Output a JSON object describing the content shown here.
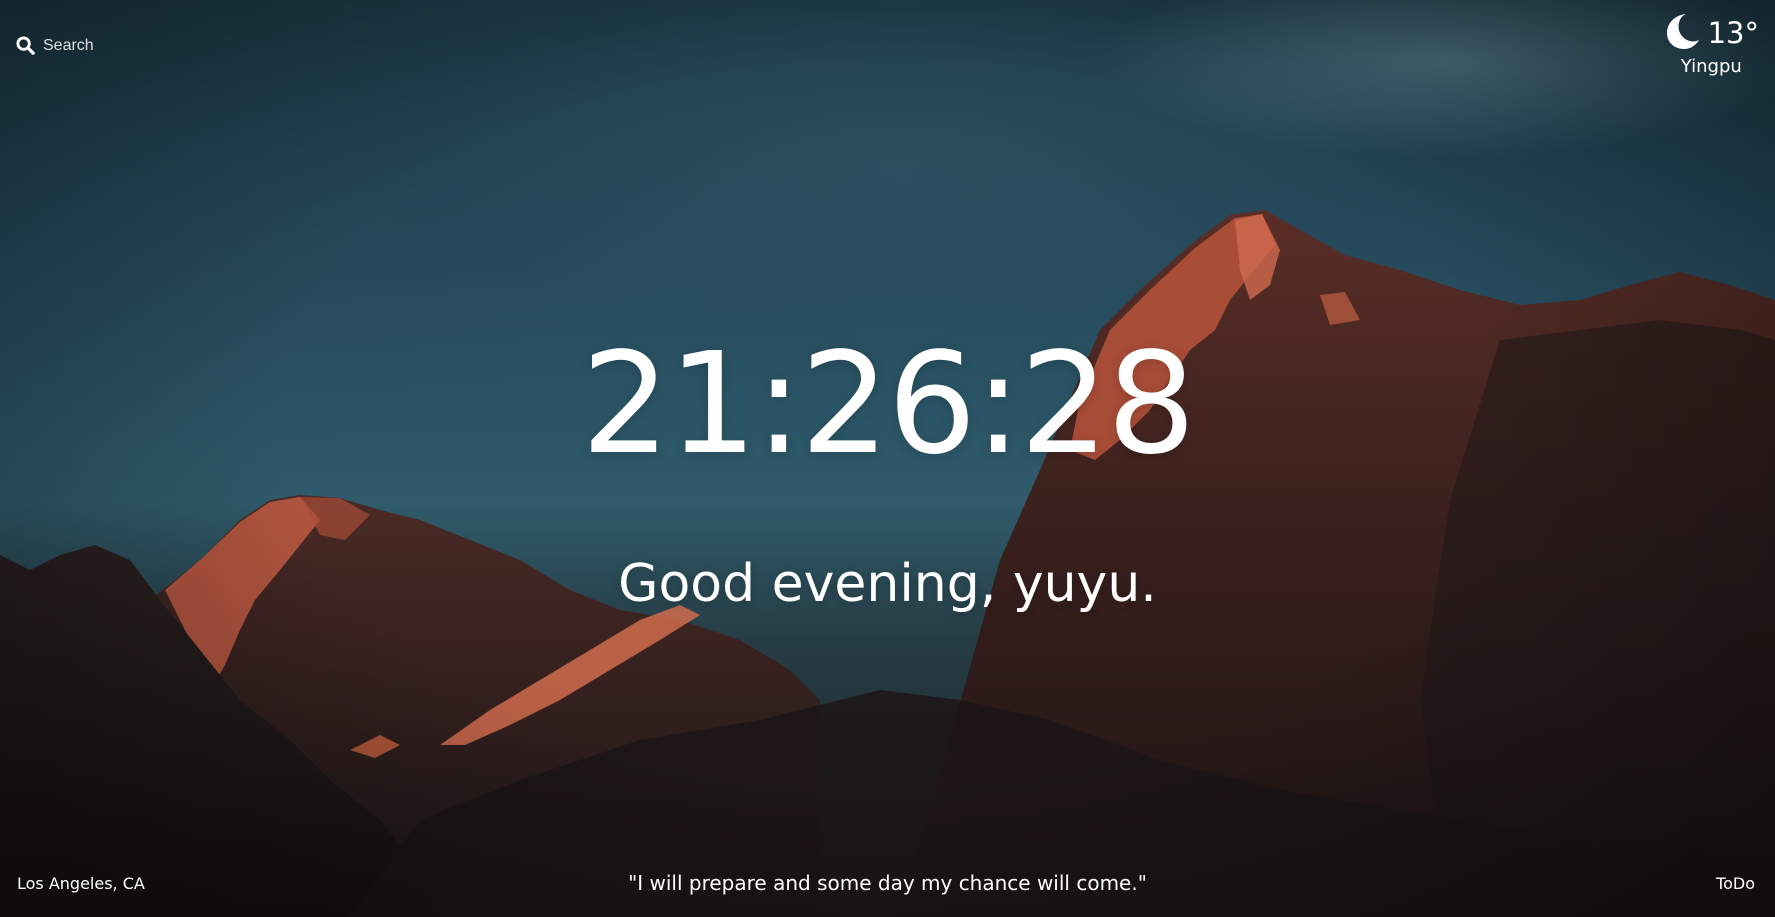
{
  "search": {
    "placeholder": "Search"
  },
  "weather": {
    "temperature": "13°",
    "location": "Yingpu",
    "icon": "moon-icon"
  },
  "clock": {
    "time": "21:26:28"
  },
  "greeting": {
    "text": "Good evening, yuyu."
  },
  "footer": {
    "location": "Los Angeles, CA",
    "quote": "\"I will prepare and some day my chance will come.\"",
    "todo_label": "ToDo"
  },
  "colors": {
    "text": "#ffffff",
    "sky": "#2b5566",
    "rock_highlight": "#c45a40"
  }
}
